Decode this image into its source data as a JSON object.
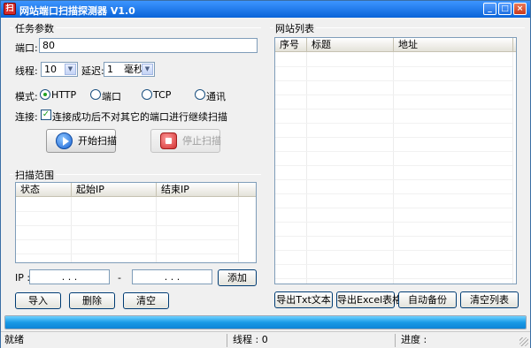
{
  "window": {
    "title": "网站端口扫描探测器 V1.0",
    "icon_glyph": "扫",
    "icon": "app-icon",
    "min_glyph": "_",
    "max_glyph": "□",
    "close_glyph": "×"
  },
  "task": {
    "group_title": "任务参数",
    "port_label": "端口:",
    "port_value": "80",
    "threads_label": "线程:",
    "threads_value": "10",
    "delay_label": "延迟:",
    "delay_value": "1",
    "delay_unit": "毫秒",
    "mode_label": "模式:",
    "modes": [
      "HTTP",
      "端口",
      "TCP",
      "通讯"
    ],
    "mode_selected": "HTTP",
    "connect_label": "连接:",
    "connect_option": "连接成功后不对其它的端口进行继续扫描",
    "connect_checked": true,
    "start_button": "开始扫描",
    "stop_button": "停止扫描"
  },
  "range": {
    "group_title": "扫描范围",
    "columns": [
      "状态",
      "起始IP",
      "结束IP"
    ],
    "rows": [],
    "ip_label": "IP :",
    "ip_from": ".    .    .",
    "dash": "-",
    "ip_to": ".    .    .",
    "add_button": "添加",
    "import_button": "导入",
    "delete_button": "删除",
    "clear_button": "清空"
  },
  "sites": {
    "group_title": "网站列表",
    "columns": [
      "序号",
      "标题",
      "地址"
    ],
    "rows": [],
    "export_txt": "导出Txt文本",
    "export_excel": "导出Excel表格",
    "auto_backup": "自动备份",
    "clear_list": "清空列表"
  },
  "progress": {
    "value": 1.0
  },
  "status": {
    "ready": "就绪",
    "threads": "线程 : 0",
    "progress": "进度 :"
  }
}
